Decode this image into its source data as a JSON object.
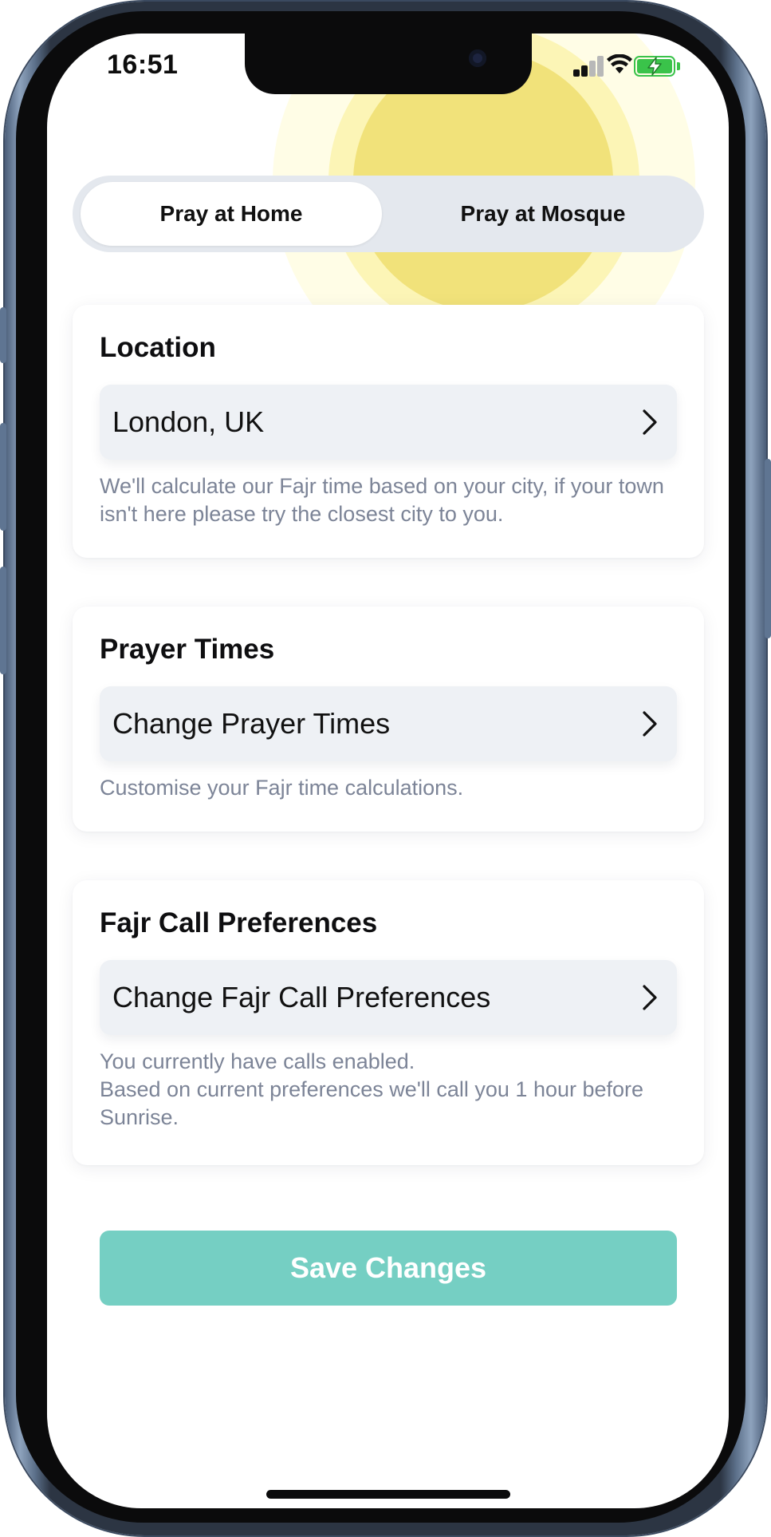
{
  "status_bar": {
    "time": "16:51",
    "signal_icon": "cellular-signal-icon",
    "wifi_icon": "wifi-icon",
    "battery_icon": "battery-charging-icon",
    "battery_color": "#3ac34a"
  },
  "segmented_control": {
    "options": [
      {
        "label": "Pray at Home",
        "selected": true
      },
      {
        "label": "Pray at Mosque",
        "selected": false
      }
    ]
  },
  "sections": {
    "location": {
      "title": "Location",
      "row_label": "London, UK",
      "description": "We'll calculate our Fajr time based on your city, if your town isn't here please try the closest city to you."
    },
    "prayer_times": {
      "title": "Prayer Times",
      "row_label": "Change Prayer Times",
      "description": "Customise your Fajr time calculations."
    },
    "fajr_call": {
      "title": "Fajr Call Preferences",
      "row_label": "Change Fajr Call Preferences",
      "description_line1": "You currently have calls enabled.",
      "description_line2": "Based on current preferences we'll call you 1 hour before Sunrise."
    }
  },
  "save_button": {
    "label": "Save Changes",
    "color": "#75cfc3"
  },
  "colors": {
    "accent": "#75cfc3",
    "row_background": "#eef1f5",
    "segment_background": "#e4e8ee",
    "muted_text": "#7c8497",
    "sun": "#f1e27a"
  }
}
